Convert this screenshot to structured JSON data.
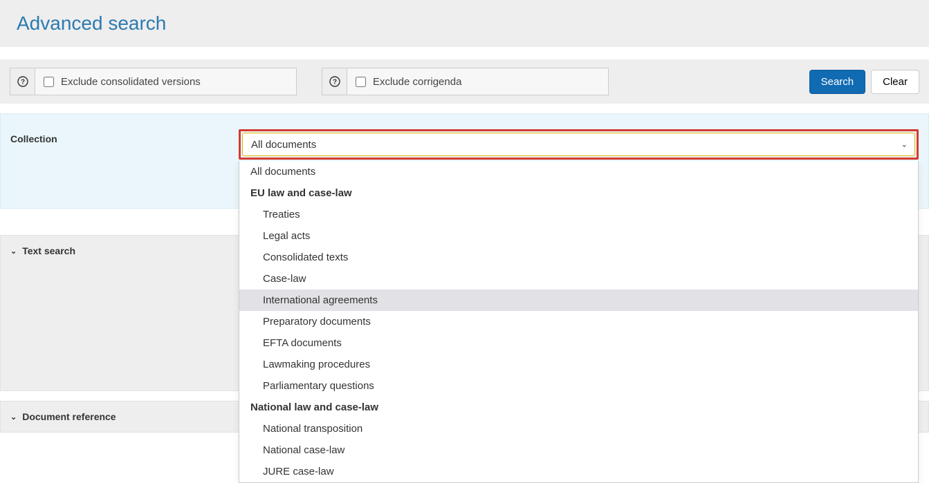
{
  "header": {
    "title": "Advanced search"
  },
  "topbar": {
    "exclude_consolidated_label": "Exclude consolidated versions",
    "exclude_corrigenda_label": "Exclude corrigenda",
    "search_label": "Search",
    "clear_label": "Clear"
  },
  "collection": {
    "label": "Collection",
    "selected": "All documents",
    "options": [
      {
        "label": "All documents",
        "type": "item",
        "highlighted": false
      },
      {
        "label": "EU law and case-law",
        "type": "group",
        "highlighted": false
      },
      {
        "label": "Treaties",
        "type": "child",
        "highlighted": false
      },
      {
        "label": "Legal acts",
        "type": "child",
        "highlighted": false
      },
      {
        "label": "Consolidated texts",
        "type": "child",
        "highlighted": false
      },
      {
        "label": "Case-law",
        "type": "child",
        "highlighted": false
      },
      {
        "label": "International agreements",
        "type": "child",
        "highlighted": true
      },
      {
        "label": "Preparatory documents",
        "type": "child",
        "highlighted": false
      },
      {
        "label": "EFTA documents",
        "type": "child",
        "highlighted": false
      },
      {
        "label": "Lawmaking procedures",
        "type": "child",
        "highlighted": false
      },
      {
        "label": "Parliamentary questions",
        "type": "child",
        "highlighted": false
      },
      {
        "label": "National law and case-law",
        "type": "group",
        "highlighted": false
      },
      {
        "label": "National transposition",
        "type": "child",
        "highlighted": false
      },
      {
        "label": "National case-law",
        "type": "child",
        "highlighted": false
      },
      {
        "label": "JURE case-law",
        "type": "child",
        "highlighted": false
      }
    ]
  },
  "accordions": {
    "text_search": "Text search",
    "document_reference": "Document reference"
  }
}
